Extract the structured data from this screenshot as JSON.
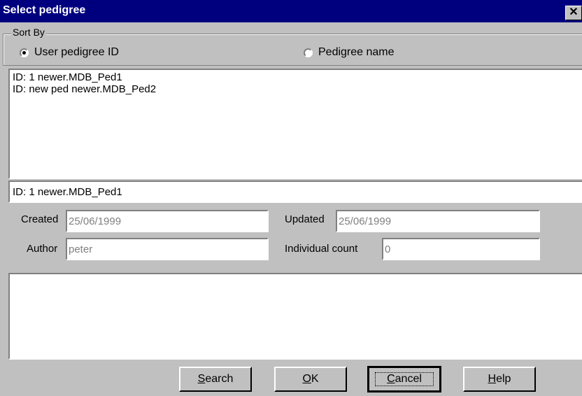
{
  "window": {
    "title": "Select pedigree",
    "close_glyph": "✕"
  },
  "sort_by": {
    "label": "Sort By",
    "options": [
      {
        "label": "User pedigree ID",
        "selected": true
      },
      {
        "label": "Pedigree name",
        "selected": false
      }
    ]
  },
  "list": {
    "items": [
      "ID: 1 newer.MDB_Ped1",
      "ID: new ped newer.MDB_Ped2"
    ]
  },
  "selected_item": "ID: 1 newer.MDB_Ped1",
  "details": {
    "created_label": "Created",
    "created_value": "25/06/1999",
    "updated_label": "Updated",
    "updated_value": "25/06/1999",
    "author_label": "Author",
    "author_value": "peter",
    "individual_count_label": "Individual count",
    "individual_count_value": "0"
  },
  "buttons": {
    "search": {
      "first": "S",
      "rest": "earch"
    },
    "ok": {
      "first": "O",
      "rest": "K"
    },
    "cancel": {
      "first": "C",
      "rest": "ancel"
    },
    "help": {
      "first": "H",
      "rest": "elp"
    }
  }
}
